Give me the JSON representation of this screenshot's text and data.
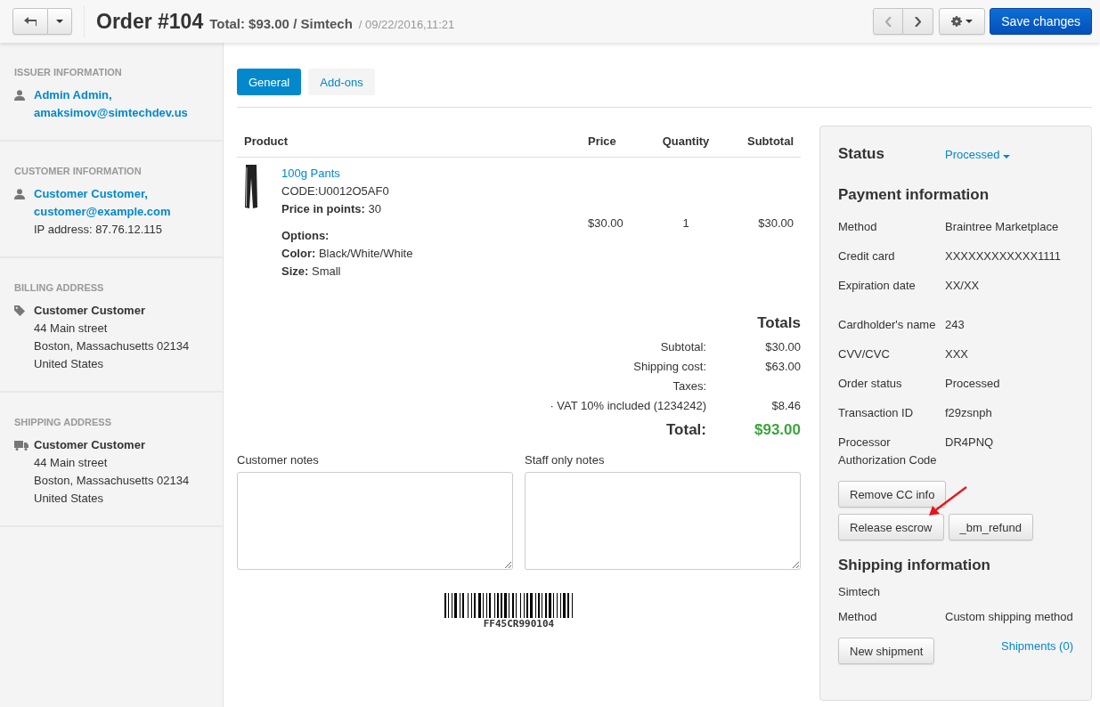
{
  "header": {
    "title": "Order #104",
    "subtitle": "Total: $93.00 / Simtech",
    "date": "/ 09/22/2016,11:21",
    "save_button": "Save changes"
  },
  "sidebar": [
    {
      "heading": "ISSUER INFORMATION",
      "kind": "person",
      "lines": [
        {
          "kind": "link",
          "text": "Admin Admin,"
        },
        {
          "kind": "link",
          "text": "amaksimov@simtechdev.us"
        }
      ]
    },
    {
      "heading": "CUSTOMER INFORMATION",
      "kind": "person",
      "lines": [
        {
          "kind": "link",
          "text": "Customer Customer,"
        },
        {
          "kind": "link",
          "text": "customer@example.com"
        },
        {
          "kind": "text",
          "text": "IP address: 87.76.12.115"
        }
      ]
    },
    {
      "heading": "BILLING ADDRESS",
      "kind": "tag",
      "lines": [
        {
          "kind": "bold",
          "text": "Customer Customer"
        },
        {
          "kind": "text",
          "text": "44 Main street"
        },
        {
          "kind": "text",
          "text": "Boston, Massachusetts 02134"
        },
        {
          "kind": "text",
          "text": "United States"
        }
      ]
    },
    {
      "heading": "SHIPPING ADDRESS",
      "kind": "truck",
      "lines": [
        {
          "kind": "bold",
          "text": "Customer Customer"
        },
        {
          "kind": "text",
          "text": "44 Main street"
        },
        {
          "kind": "text",
          "text": "Boston, Massachusetts 02134"
        },
        {
          "kind": "text",
          "text": "United States"
        }
      ]
    }
  ],
  "tabs": [
    {
      "label": "General",
      "selected": true
    },
    {
      "label": "Add-ons",
      "selected": false
    }
  ],
  "products": {
    "columns": [
      "Product",
      "Price",
      "Quantity",
      "Subtotal"
    ],
    "rows": [
      {
        "name": "100g Pants",
        "code": "CODE:U0012O5AF0",
        "points": "**Price in points:** 30",
        "options_title": "Options:",
        "options": [
          "**Color:** Black/White/White",
          "**Size:** Small"
        ],
        "price": "$30.00",
        "quantity": "1",
        "subtotal": "$30.00"
      }
    ]
  },
  "totals": {
    "title": "Totals",
    "rows": [
      {
        "label": "Subtotal:",
        "value": "$30.00"
      },
      {
        "label": "Shipping cost:",
        "value": "$63.00"
      },
      {
        "label": "Taxes:"
      },
      {
        "label": "· VAT 10% included (1234242)",
        "value": "$8.46"
      }
    ],
    "total_label": "Total:",
    "total_value": "$93.00"
  },
  "notes": [
    {
      "label": "Customer notes"
    },
    {
      "label": "Staff only notes"
    }
  ],
  "barcode": {
    "code": "FF45CR990104"
  },
  "panel": {
    "status_label": "Status",
    "status_value": "Processed",
    "payment_title": "Payment information",
    "payment_rows": [
      {
        "label": "Method",
        "value": "Braintree Marketplace"
      },
      {
        "label": "Credit card",
        "value": "XXXXXXXXXXXX1111"
      },
      {
        "label": "Expiration date",
        "value": "XX/XX"
      },
      {
        "label": "Cardholder's name",
        "value": "243"
      },
      {
        "label": "CVV/CVC",
        "value": "XXX"
      },
      {
        "label": "Order status",
        "value": "Processed"
      },
      {
        "label": "Transaction ID",
        "value": "f29zsnph"
      },
      {
        "label": "Processor Authorization Code",
        "value": "DR4PNQ"
      }
    ],
    "button_rows": [
      [
        "Remove CC info"
      ],
      [
        "Release escrow",
        "_bm_refund"
      ]
    ],
    "shipping_title": "Shipping information",
    "carrier": "Simtech",
    "shipping_rows": [
      {
        "label": "Method",
        "value": "Custom shipping method"
      }
    ],
    "shipment_button": "New shipment",
    "shipments_link": "Shipments (0)"
  }
}
